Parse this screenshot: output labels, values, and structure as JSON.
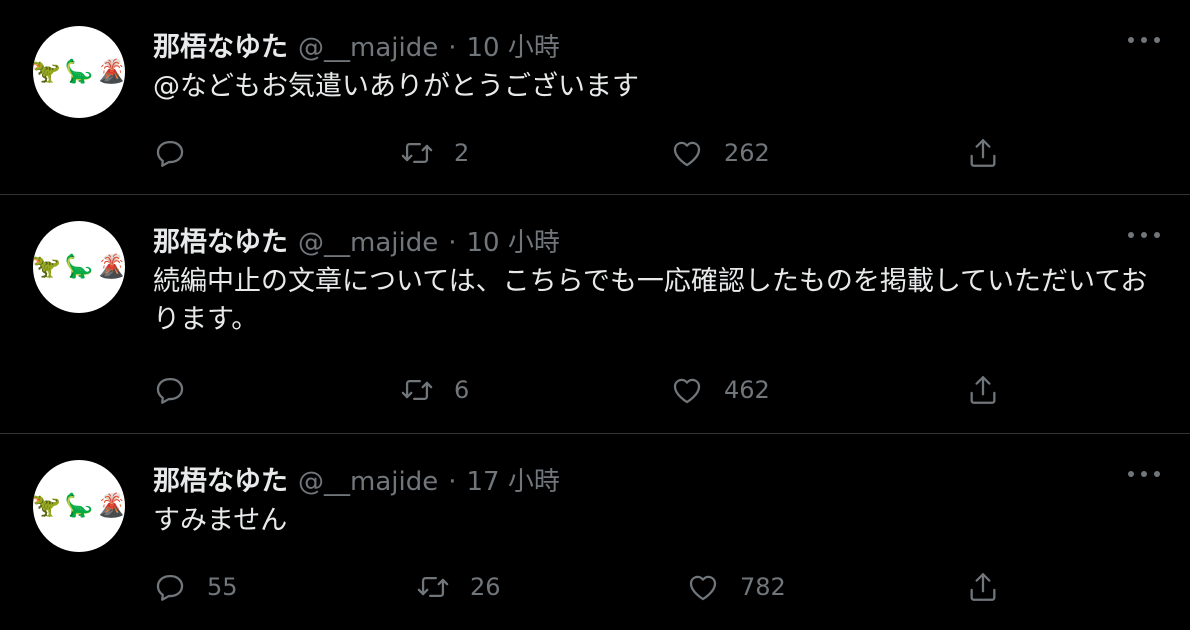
{
  "tweets": [
    {
      "author": {
        "name": "那梧なゆた",
        "handle": "@__majide",
        "separator": "·",
        "time": "10 小時",
        "avatar_emoji": [
          "🦖",
          "🦕",
          "🌋"
        ]
      },
      "text": "@などもお気遣いありがとうございます",
      "actions": {
        "reply_count": "",
        "retweet_count": "2",
        "like_count": "262"
      },
      "icons": {
        "reply": "reply-icon",
        "retweet": "retweet-icon",
        "like": "heart-icon",
        "share": "share-icon",
        "more": "more-icon"
      }
    },
    {
      "author": {
        "name": "那梧なゆた",
        "handle": "@__majide",
        "separator": "·",
        "time": "10 小時",
        "avatar_emoji": [
          "🦖",
          "🦕",
          "🌋"
        ]
      },
      "text": "続編中止の文章については、こちらでも一応確認したものを掲載していただいております。",
      "actions": {
        "reply_count": "",
        "retweet_count": "6",
        "like_count": "462"
      },
      "icons": {
        "reply": "reply-icon",
        "retweet": "retweet-icon",
        "like": "heart-icon",
        "share": "share-icon",
        "more": "more-icon"
      }
    },
    {
      "author": {
        "name": "那梧なゆた",
        "handle": "@__majide",
        "separator": "·",
        "time": "17 小時",
        "avatar_emoji": [
          "🦖",
          "🦕",
          "🌋"
        ]
      },
      "text": "すみません",
      "actions": {
        "reply_count": "55",
        "retweet_count": "26",
        "like_count": "782"
      },
      "icons": {
        "reply": "reply-icon",
        "retweet": "retweet-icon",
        "like": "heart-icon",
        "share": "share-icon",
        "more": "more-icon"
      }
    }
  ],
  "theme": {
    "background": "#000000",
    "text_primary": "#e7e9ea",
    "text_secondary": "#71767b",
    "divider": "#2f3336"
  }
}
